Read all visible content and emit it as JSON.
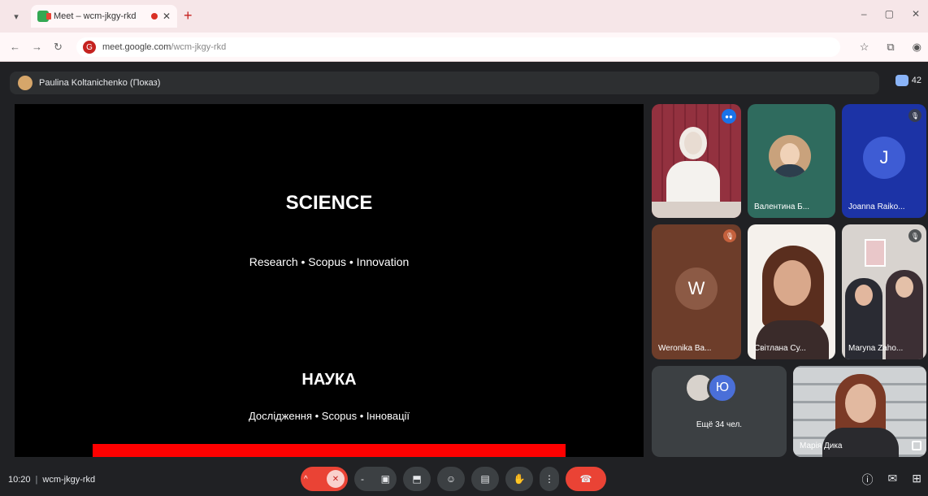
{
  "browser": {
    "tab_title": "Meet – wcm-jkgy-rkd",
    "url_host": "meet.google.com",
    "url_path": "/wcm-jkgy-rkd",
    "new_tab": "+",
    "win_min": "–",
    "win_max": "▢",
    "win_close": "✕",
    "nav_back": "←",
    "nav_forward": "→",
    "nav_reload": "↻",
    "site_icon": "G"
  },
  "presenter": {
    "label": "Paulina Koltanichenko (Показ)",
    "participant_count": "42"
  },
  "slide": {
    "title_en": "SCIENCE",
    "subtitle_en": "Research • Scopus • Innovation",
    "title_ua": "НАУКА",
    "subtitle_ua": "Дослідження • Scopus • Інновації"
  },
  "tiles": [
    {
      "name": ""
    },
    {
      "name": "Валентина Б..."
    },
    {
      "name": "Joanna Raiko...",
      "letter": "J"
    },
    {
      "name": "Weronika Ba...",
      "letter": "W"
    },
    {
      "name": "Світлана Су..."
    },
    {
      "name": "Maryna Zaho..."
    },
    {
      "name": "Ещё 34 чел.",
      "letter": "Ю"
    },
    {
      "name": "Марія Дика"
    }
  ],
  "bottom": {
    "time": "10:20",
    "separator": "|",
    "meeting_code": "wcm-jkgy-rkd"
  },
  "icons": {
    "caret": "^",
    "mic_off": "✕",
    "camera": "▣",
    "present": "⬒",
    "emoji": "☺",
    "captions": "▤",
    "hand": "✋",
    "more": "⋮",
    "end_call": "☎",
    "info": "ⓘ",
    "chat": "✉",
    "apps": "⊞",
    "more_dash": "-"
  },
  "colors": {
    "end_call": "#ea4335",
    "slide_bar": "#ff0000"
  }
}
